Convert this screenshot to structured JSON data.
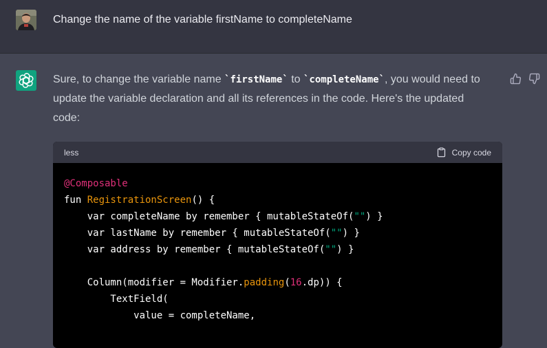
{
  "user": {
    "message": "Change the name of the variable firstName to completeName"
  },
  "assistant": {
    "reply_before": "Sure, to change the variable name ",
    "code_old": "`firstName`",
    "reply_mid": " to ",
    "code_new": "`completeName`",
    "reply_after": ", you would need to update the variable declaration and all its references in the code. Here's the updated code:"
  },
  "code_block": {
    "language": "less",
    "copy_label": "Copy code",
    "lines": {
      "l1_ann": "@Composable",
      "l2_kw": "fun ",
      "l2_fn": "RegistrationScreen",
      "l2_rest": "() {",
      "l3_a": "    var completeName by remember { mutableStateOf(",
      "l3_str": "\"\"",
      "l3_b": ") }",
      "l4_a": "    var lastName by remember { mutableStateOf(",
      "l4_str": "\"\"",
      "l4_b": ") }",
      "l5_a": "    var address by remember { mutableStateOf(",
      "l5_str": "\"\"",
      "l5_b": ") }",
      "l7_a": "    Column(modifier = Modifier.",
      "l7_fn": "padding",
      "l7_b": "(",
      "l7_num": "16",
      "l7_c": ".dp)) {",
      "l8": "        TextField(",
      "l9": "            value = completeName,"
    }
  },
  "colors": {
    "user_bg": "#343541",
    "assistant_bg": "#444654",
    "brand_green": "#10a37f",
    "code_bg": "#000000"
  },
  "icons": [
    "user-avatar",
    "openai-logo-icon",
    "thumbs-up-icon",
    "thumbs-down-icon",
    "clipboard-icon"
  ]
}
